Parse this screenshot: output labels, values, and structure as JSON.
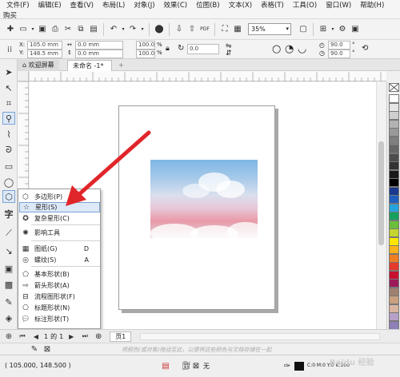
{
  "menubar": {
    "items": [
      "文件(F)",
      "编辑(E)",
      "查看(V)",
      "布局(L)",
      "对象(J)",
      "效果(C)",
      "位图(B)",
      "文本(X)",
      "表格(T)",
      "工具(O)",
      "窗口(W)",
      "帮助(H)"
    ],
    "second_row": "购买"
  },
  "toolbar": {
    "zoom_value": "35%",
    "pdf_label": "PDF"
  },
  "property_bar": {
    "x_value": "105.0 mm",
    "y_value": "148.5 mm",
    "w_value": "0.0 mm",
    "h_value": "0.0 mm",
    "sx_value": "100.0",
    "sy_value": "100.0",
    "rotation_value": "0.0",
    "angle1_value": "90.0",
    "angle2_value": "90.0",
    "deg_unit": "°"
  },
  "tabs": {
    "home_icon": "home-icon",
    "welcome": "欢迎屏幕",
    "doc": "未命名 -1*",
    "add": "+"
  },
  "flyout": {
    "items": [
      {
        "label": "多边形(P)",
        "icon": "polygon-icon",
        "key": ""
      },
      {
        "label": "星形(S)",
        "icon": "star-icon",
        "key": ""
      },
      {
        "label": "复杂星形(C)",
        "icon": "complex-star-icon",
        "key": ""
      },
      {
        "label": "影响工具",
        "icon": "impact-tool-icon",
        "key": ""
      },
      {
        "label": "图纸(G)",
        "icon": "graph-paper-icon",
        "key": "D"
      },
      {
        "label": "螺纹(S)",
        "icon": "spiral-icon",
        "key": "A"
      },
      {
        "label": "基本形状(B)",
        "icon": "basic-shapes-icon",
        "key": ""
      },
      {
        "label": "箭头形状(A)",
        "icon": "arrow-shapes-icon",
        "key": ""
      },
      {
        "label": "流程图形状(F)",
        "icon": "flowchart-shapes-icon",
        "key": ""
      },
      {
        "label": "标题形状(N)",
        "icon": "banner-shapes-icon",
        "key": ""
      },
      {
        "label": "标注形状(T)",
        "icon": "callout-shapes-icon",
        "key": ""
      }
    ]
  },
  "page_nav": {
    "current": "1",
    "of": "的",
    "total": "1",
    "page_tab": "页1"
  },
  "docbar": {
    "hint": "将颜色(或对象)拖动至此，以便将这些颜色与文档存储在一起"
  },
  "status": {
    "coords": "( 105.000, 148.500 )",
    "fill_label": "无",
    "color_info": "C:0 M:0 Y:0 K:100",
    "watermark": "Baidu 经验"
  },
  "palette_colors": [
    "#ffffff",
    "#e6e6e6",
    "#cfcfcf",
    "#b3b3b3",
    "#999999",
    "#7f7f7f",
    "#666666",
    "#4d4d4d",
    "#333333",
    "#1a1a1a",
    "#000000",
    "#1b3a8c",
    "#1f5fbf",
    "#26a3dd",
    "#17a05d",
    "#6abf3a",
    "#c3d52e",
    "#ffe600",
    "#f8b21c",
    "#ef7d22",
    "#e53b2c",
    "#c8102e",
    "#9b1b5a",
    "#a08070",
    "#c8a07f",
    "#d8b4a0",
    "#b7a0c8",
    "#8f7fb8"
  ],
  "colors": {
    "accent": "#4a7fc1",
    "arrow": "#e0262a",
    "highlight": "#dde9f7"
  }
}
